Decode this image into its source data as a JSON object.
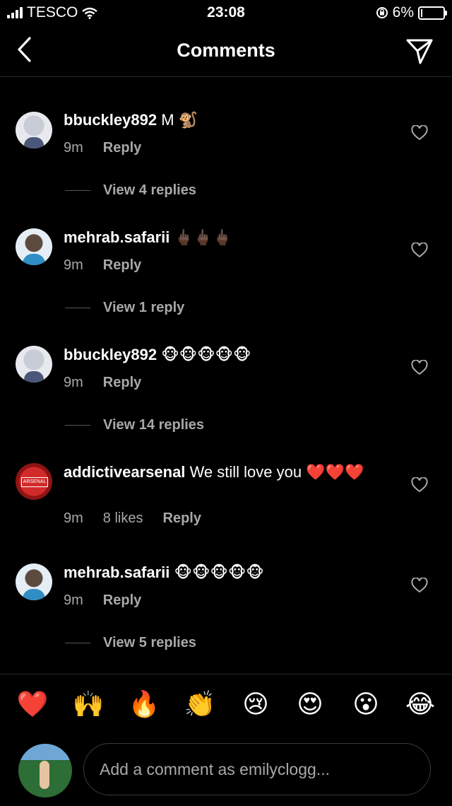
{
  "status_bar": {
    "carrier": "TESCO",
    "time": "23:08",
    "battery": "6%",
    "battery_level": 0.06
  },
  "header": {
    "title": "Comments"
  },
  "comments": [
    {
      "username": "bbuckley892",
      "text": "M 🐒",
      "time": "9m",
      "reply_label": "Reply",
      "view_replies": "View 4 replies"
    },
    {
      "username": "mehrab.safarii",
      "text": "🖕🏿🖕🏿🖕🏿",
      "time": "9m",
      "reply_label": "Reply",
      "view_replies": "View 1 reply"
    },
    {
      "username": "bbuckley892",
      "text": "🐵🐵🐵🐵🐵",
      "time": "9m",
      "reply_label": "Reply",
      "view_replies": "View 14 replies"
    },
    {
      "username": "addictivearsenal",
      "text": "We still love you ❤️❤️❤️",
      "time": "9m",
      "likes": "8 likes",
      "reply_label": "Reply",
      "avatar_text": "ARSENAL"
    },
    {
      "username": "mehrab.safarii",
      "text": "🐵🐵🐵🐵🐵",
      "time": "9m",
      "reply_label": "Reply",
      "view_replies": "View 5 replies"
    }
  ],
  "quick_reactions": [
    "❤️",
    "🙌",
    "🔥",
    "👏",
    "😢",
    "😍",
    "😮",
    "😂"
  ],
  "composer": {
    "placeholder": "Add a comment as emilyclogg..."
  },
  "colors": {
    "background": "#000000",
    "secondary_text": "#a8a8a8",
    "divider": "#262626"
  }
}
